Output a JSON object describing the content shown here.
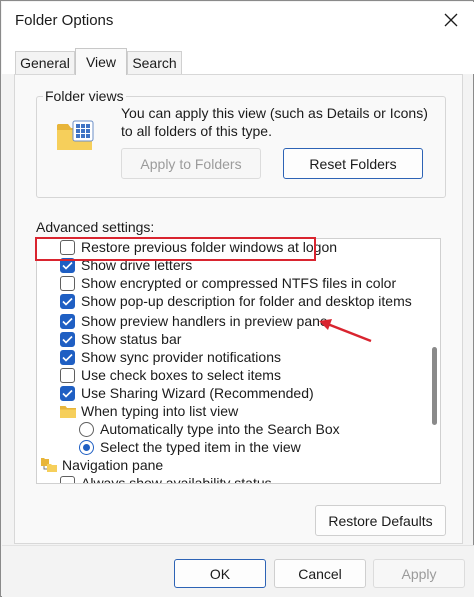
{
  "window": {
    "title": "Folder Options",
    "close_icon": "close-icon"
  },
  "tabs": [
    {
      "label": "General",
      "selected": false
    },
    {
      "label": "View",
      "selected": true
    },
    {
      "label": "Search",
      "selected": false
    }
  ],
  "folder_views": {
    "group_label": "Folder views",
    "description": "You can apply this view (such as Details or Icons) to all folders of this type.",
    "apply_button": "Apply to Folders",
    "reset_button": "Reset Folders",
    "icon": "folder-grid-icon"
  },
  "advanced": {
    "label": "Advanced settings:",
    "items": [
      {
        "kind": "checkbox",
        "checked": false,
        "label": "Restore previous folder windows at logon"
      },
      {
        "kind": "checkbox",
        "checked": true,
        "label": "Show drive letters"
      },
      {
        "kind": "checkbox",
        "checked": false,
        "label": "Show encrypted or compressed NTFS files in color"
      },
      {
        "kind": "checkbox",
        "checked": true,
        "label": "Show pop-up description for folder and desktop items"
      },
      {
        "kind": "checkbox",
        "checked": true,
        "label": "Show preview handlers in preview pane",
        "highlighted": true
      },
      {
        "kind": "checkbox",
        "checked": true,
        "label": "Show status bar"
      },
      {
        "kind": "checkbox",
        "checked": true,
        "label": "Show sync provider notifications"
      },
      {
        "kind": "checkbox",
        "checked": false,
        "label": "Use check boxes to select items"
      },
      {
        "kind": "checkbox",
        "checked": true,
        "label": "Use Sharing Wizard (Recommended)"
      },
      {
        "kind": "folder",
        "label": "When typing into list view"
      },
      {
        "kind": "radio",
        "checked": false,
        "label": "Automatically type into the Search Box"
      },
      {
        "kind": "radio",
        "checked": true,
        "label": "Select the typed item in the view"
      },
      {
        "kind": "category",
        "label": "Navigation pane"
      },
      {
        "kind": "checkbox",
        "checked": false,
        "label": "Always show availability status"
      }
    ],
    "restore_defaults": "Restore Defaults"
  },
  "footer": {
    "ok": "OK",
    "cancel": "Cancel",
    "apply": "Apply"
  },
  "colors": {
    "accent": "#1f5fc3",
    "annotation": "#d9242f"
  }
}
